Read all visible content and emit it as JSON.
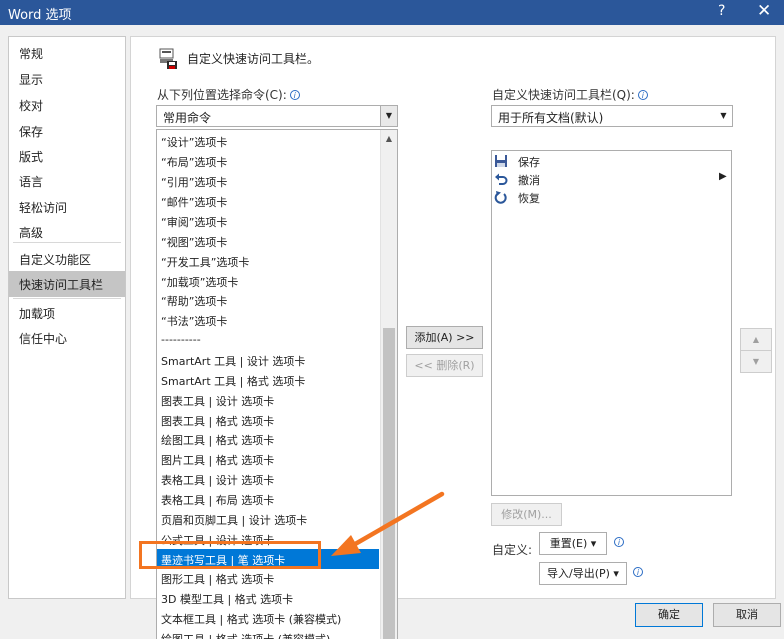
{
  "window": {
    "title": "Word 选项",
    "help": "?",
    "close": "✕"
  },
  "nav": {
    "items": [
      "常规",
      "显示",
      "校对",
      "保存",
      "版式",
      "语言",
      "轻松访问",
      "高级",
      "自定义功能区",
      "快速访问工具栏",
      "加载项",
      "信任中心"
    ],
    "active_index": 9
  },
  "main": {
    "heading": "自定义快速访问工具栏。",
    "choose_label": "从下列位置选择命令(C):",
    "choose_value": "常用命令",
    "qat_label": "自定义快速访问工具栏(Q):",
    "qat_value": "用于所有文档(默认)",
    "commands": [
      "“设计”选项卡",
      "“布局”选项卡",
      "“引用”选项卡",
      "“邮件”选项卡",
      "“审阅”选项卡",
      "“视图”选项卡",
      "“开发工具”选项卡",
      "“加载项”选项卡",
      "“帮助”选项卡",
      "“书法”选项卡",
      "----------",
      "SmartArt 工具 | 设计 选项卡",
      "SmartArt 工具 | 格式 选项卡",
      "图表工具 | 设计 选项卡",
      "图表工具 | 格式 选项卡",
      "绘图工具 | 格式 选项卡",
      "图片工具 | 格式 选项卡",
      "表格工具 | 设计 选项卡",
      "表格工具 | 布局 选项卡",
      "页眉和页脚工具 | 设计 选项卡",
      "公式工具 | 设计 选项卡",
      "墨迹书写工具 | 笔 选项卡",
      "图形工具 | 格式 选项卡",
      "3D 模型工具 | 格式 选项卡",
      "文本框工具 | 格式 选项卡 (兼容模式)",
      "绘图工具 | 格式 选项卡 (兼容模式)"
    ],
    "selected_command_index": 21,
    "qat_items": [
      {
        "label": "保存",
        "icon": "save-icon"
      },
      {
        "label": "撤消",
        "icon": "undo-icon"
      },
      {
        "label": "恢复",
        "icon": "redo-icon"
      }
    ],
    "add_button": "添加(A) >>",
    "remove_button": "<< 删除(R)",
    "modify_button": "修改(M)...",
    "customize_label": "自定义:",
    "reset_button": "重置(E) ▾",
    "import_export_button": "导入/导出(P) ▾",
    "move_up_icon": "▲",
    "move_down_icon": "▼"
  },
  "footer": {
    "ok": "确定",
    "cancel": "取消"
  },
  "colors": {
    "titlebar": "#2b579a",
    "selection": "#0078d7",
    "annotation": "#f37521"
  }
}
